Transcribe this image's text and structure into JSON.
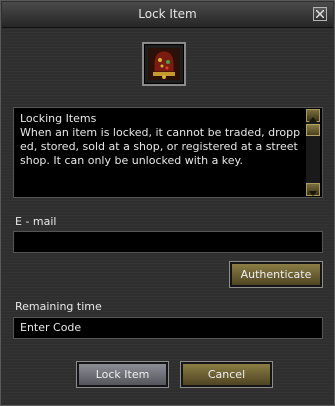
{
  "window": {
    "title": "Lock Item"
  },
  "item": {
    "icon": "bell-item-icon"
  },
  "description": {
    "heading": "Locking Items",
    "body": "When an item is locked, it cannot be traded, dropp\ned, stored, sold at a shop, or registered at a street\nshop.  It can only be unlocked with a key."
  },
  "email": {
    "label": "E - mail",
    "value": ""
  },
  "authenticate": {
    "label": "Authenticate"
  },
  "remaining": {
    "label": "Remaining time",
    "value": "Enter Code"
  },
  "actions": {
    "lock_label": "Lock Item",
    "cancel_label": "Cancel"
  },
  "colors": {
    "accent_gold": "#8a7d45",
    "button_gray": "#8d8d96",
    "panel": "#2f2f2f"
  }
}
